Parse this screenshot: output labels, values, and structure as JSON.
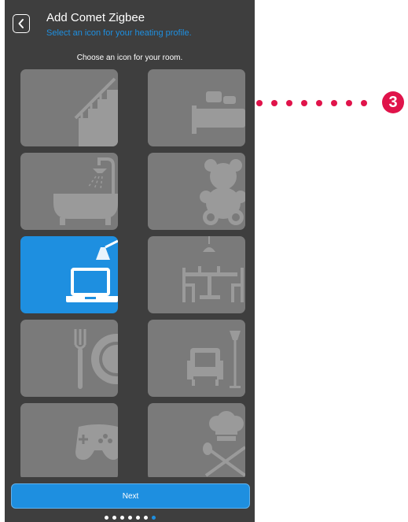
{
  "header": {
    "title": "Add Comet Zigbee",
    "subtitle": "Select an icon for your heating profile."
  },
  "prompt": "Choose an icon for your room.",
  "icons": [
    {
      "name": "stairs",
      "selected": false
    },
    {
      "name": "bed",
      "selected": false
    },
    {
      "name": "bathtub",
      "selected": false
    },
    {
      "name": "teddy-bear",
      "selected": false
    },
    {
      "name": "laptop-lamp",
      "selected": true
    },
    {
      "name": "dining-table",
      "selected": false
    },
    {
      "name": "fork-plate",
      "selected": false
    },
    {
      "name": "armchair-lamp",
      "selected": false
    },
    {
      "name": "game-controller",
      "selected": false
    },
    {
      "name": "chef-hat-utensils",
      "selected": false
    }
  ],
  "next_button": "Next",
  "pager": {
    "total": 7,
    "current": 7
  },
  "callout": {
    "number": "3"
  },
  "colors": {
    "background": "#3e3e3e",
    "tile": "#7a7a7a",
    "accent": "#1e8fe0",
    "callout": "#e0134a"
  }
}
